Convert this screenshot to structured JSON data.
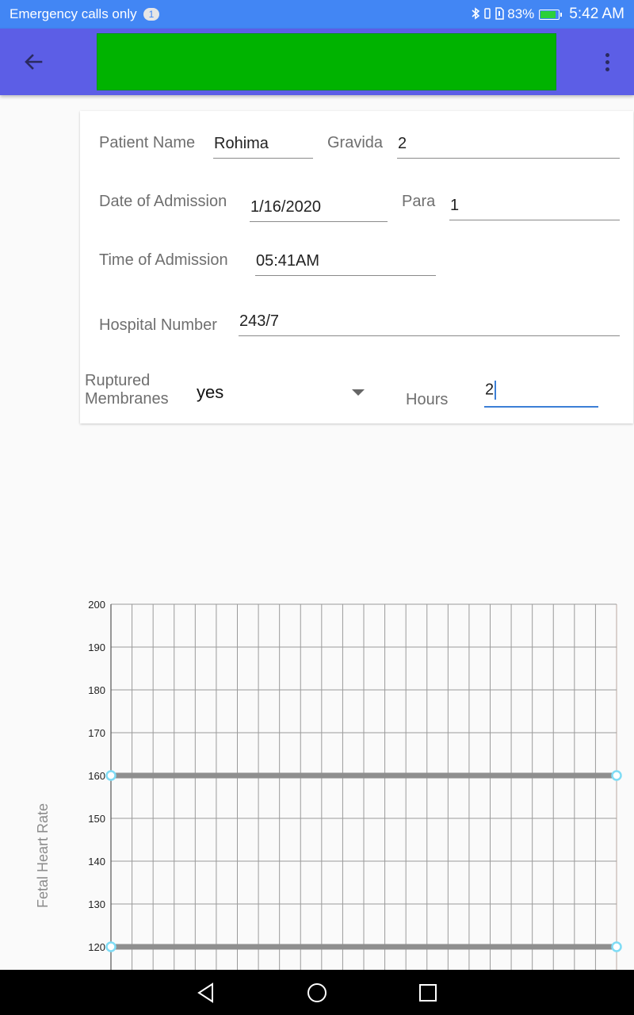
{
  "status_bar": {
    "carrier_text": "Emergency calls only",
    "notification_count": "1",
    "battery_percent": "83%",
    "battery_level": 0.83,
    "time": "5:42 AM",
    "icons": [
      "bluetooth-icon",
      "vibrate-icon",
      "sim-icon",
      "battery-charging-icon"
    ]
  },
  "app_bar": {
    "back_icon": "arrow-left-icon",
    "banner_color": "#00b300",
    "overflow_icon": "more-vertical-icon",
    "bar_color": "#5c5ee6"
  },
  "form": {
    "patient_name": {
      "label": "Patient Name",
      "value": "Rohima"
    },
    "gravida": {
      "label": "Gravida",
      "value": "2"
    },
    "date_of_admission": {
      "label": "Date of Admission",
      "value": "1/16/2020"
    },
    "para": {
      "label": "Para",
      "value": "1"
    },
    "time_of_admission": {
      "label": "Time of Admission",
      "value": "05:41AM"
    },
    "hospital_number": {
      "label": "Hospital Number",
      "value": "243/7"
    },
    "ruptured_membranes": {
      "label_line1": "Ruptured",
      "label_line2": "Membranes",
      "value": "yes"
    },
    "hours": {
      "label": "Hours",
      "value": "2"
    }
  },
  "chart_data": {
    "type": "line",
    "ylabel": "Fetal Heart Rate",
    "xlabel": "",
    "ylim": [
      120,
      200
    ],
    "yticks": [
      200,
      190,
      180,
      170,
      160,
      150,
      140,
      130,
      120
    ],
    "x_grid_columns": 24,
    "series": [
      {
        "values": [
          160,
          160
        ],
        "color": "#8f8f8f"
      },
      {
        "values": [
          120,
          120
        ],
        "color": "#8f8f8f"
      }
    ],
    "marker_color": "#7fdcf5",
    "grid": true
  },
  "nav_bar": {
    "icons": [
      "back-triangle-icon",
      "home-circle-icon",
      "recents-square-icon"
    ]
  }
}
